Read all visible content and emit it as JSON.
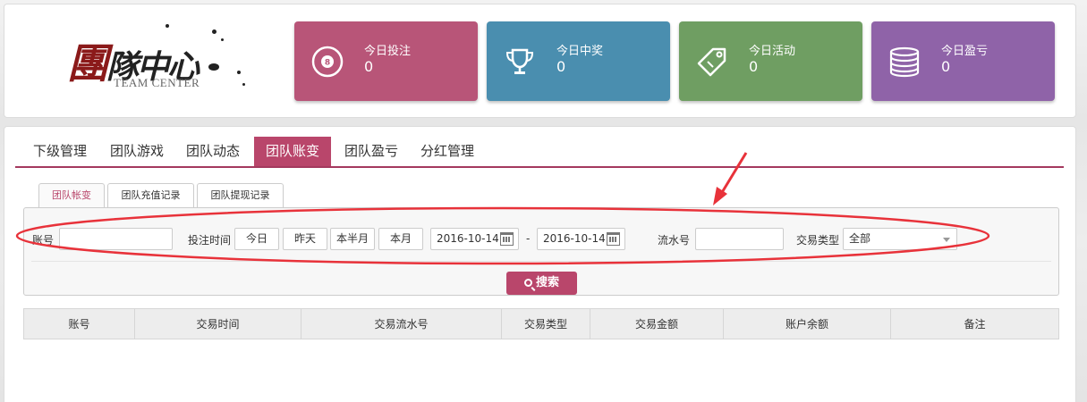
{
  "logo": {
    "cn_first": "團",
    "cn_rest": "隊中心",
    "en": "TEAM CENTER"
  },
  "stats": [
    {
      "label": "今日投注",
      "value": "0",
      "icon": "ball-icon",
      "color": "#b85578"
    },
    {
      "label": "今日中奖",
      "value": "0",
      "icon": "trophy-icon",
      "color": "#4a8eaf"
    },
    {
      "label": "今日活动",
      "value": "0",
      "icon": "tag-icon",
      "color": "#6f9e62"
    },
    {
      "label": "今日盈亏",
      "value": "0",
      "icon": "coins-icon",
      "color": "#8f63a8"
    }
  ],
  "main_tabs": [
    {
      "label": "下级管理",
      "active": false
    },
    {
      "label": "团队游戏",
      "active": false
    },
    {
      "label": "团队动态",
      "active": false
    },
    {
      "label": "团队账变",
      "active": true
    },
    {
      "label": "团队盈亏",
      "active": false
    },
    {
      "label": "分红管理",
      "active": false
    }
  ],
  "sub_tabs": [
    {
      "label": "团队帐变",
      "active": true
    },
    {
      "label": "团队充值记录",
      "active": false
    },
    {
      "label": "团队提现记录",
      "active": false
    }
  ],
  "filters": {
    "account_label": "账号",
    "account_value": "",
    "bet_time_label": "投注时间",
    "quick_ranges": [
      "今日",
      "昨天",
      "本半月",
      "本月"
    ],
    "date_from": "2016-10-14",
    "date_separator": "-",
    "date_to": "2016-10-14",
    "serial_label": "流水号",
    "serial_value": "",
    "type_label": "交易类型",
    "type_selected": "全部"
  },
  "search_button": "搜索",
  "table": {
    "headers": [
      "账号",
      "交易时间",
      "交易流水号",
      "交易类型",
      "交易金额",
      "账户余额",
      "备注"
    ]
  },
  "accent_color": "#b9466b",
  "annotation_color": "#e8323a"
}
